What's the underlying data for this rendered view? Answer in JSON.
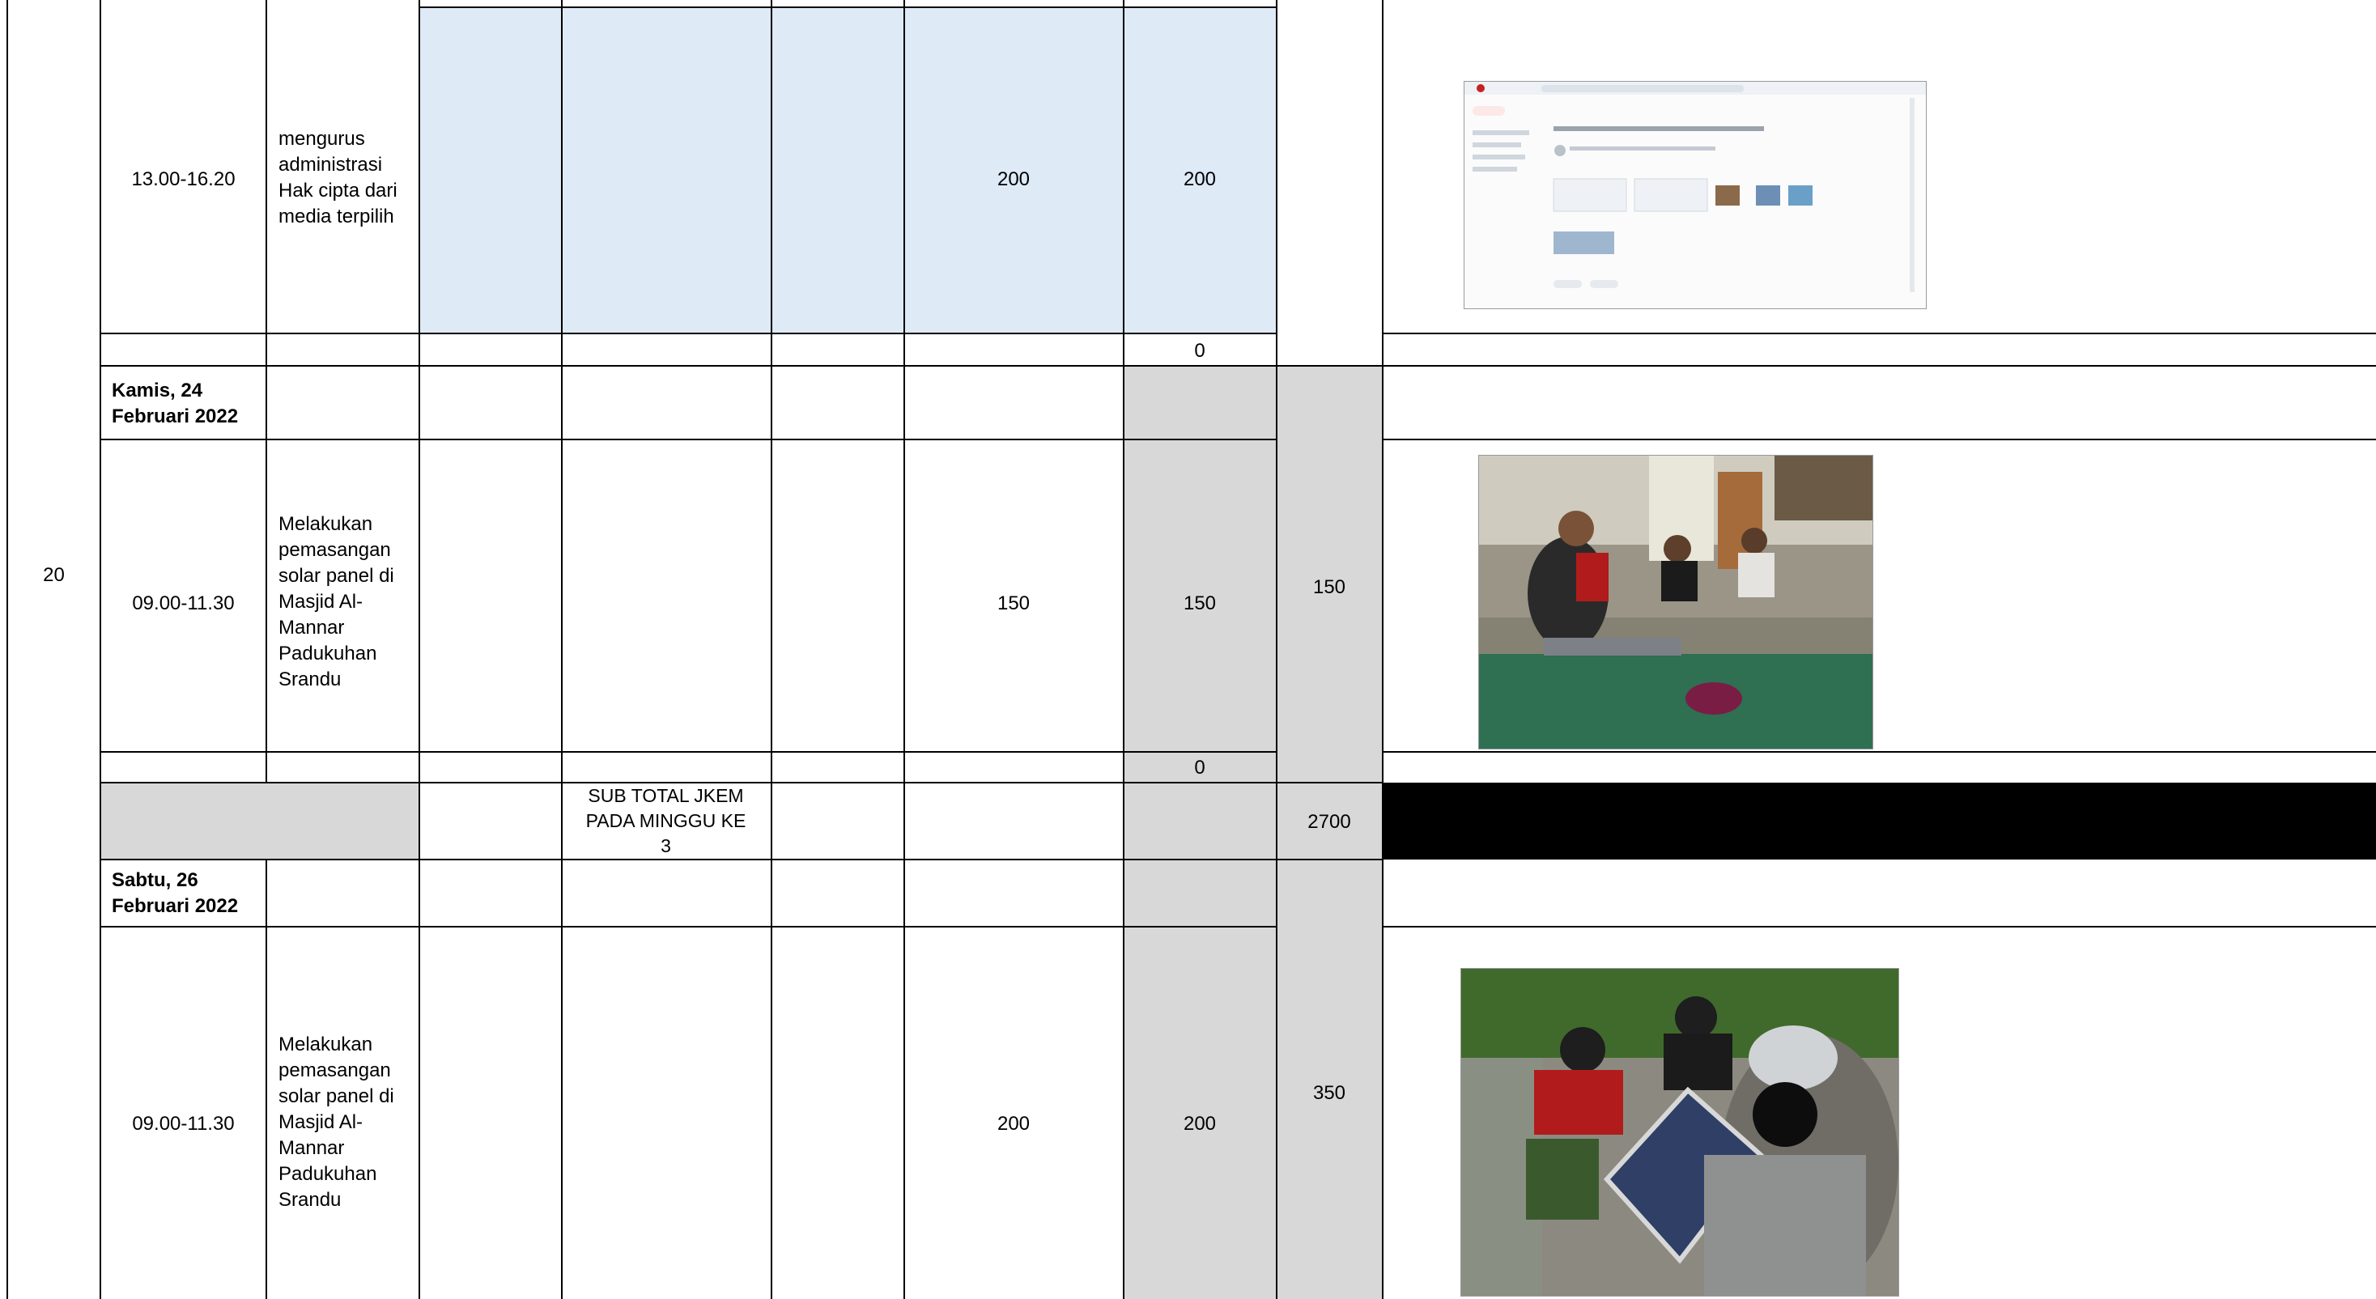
{
  "week_number": "20",
  "rows": [
    {
      "time": "13.00-16.20",
      "activity": "mengurus administrasi Hak cipta dari media terpilih",
      "value": "200",
      "hours": "200"
    },
    {
      "zero_1": "0"
    },
    {
      "date": "Kamis, 24 Februari 2022"
    },
    {
      "time": "09.00-11.30",
      "activity": "Melakukan pemasangan solar panel di Masjid Al-Mannar Padukuhan Srandu",
      "value": "150",
      "hours": "150",
      "day_total": "150"
    },
    {
      "zero_2": "0"
    }
  ],
  "subtotal": {
    "label": "SUB TOTAL JKEM PADA MINGGU KE 3",
    "value": "2700"
  },
  "saturday": {
    "date": "Sabtu, 26 Februari 2022",
    "time": "09.00-11.30",
    "activity": "Melakukan pemasangan solar panel di Masjid Al-Mannar Padukuhan Srandu",
    "value": "200",
    "hours": "200",
    "day_total": "350"
  },
  "photos": [
    "email-screenshot",
    "solar-panel-install-indoor",
    "solar-panel-install-outdoor"
  ],
  "colors": {
    "blue_fill": "#deeaf6",
    "gray_fill": "#d8d8d8",
    "black_fill": "#000000"
  }
}
